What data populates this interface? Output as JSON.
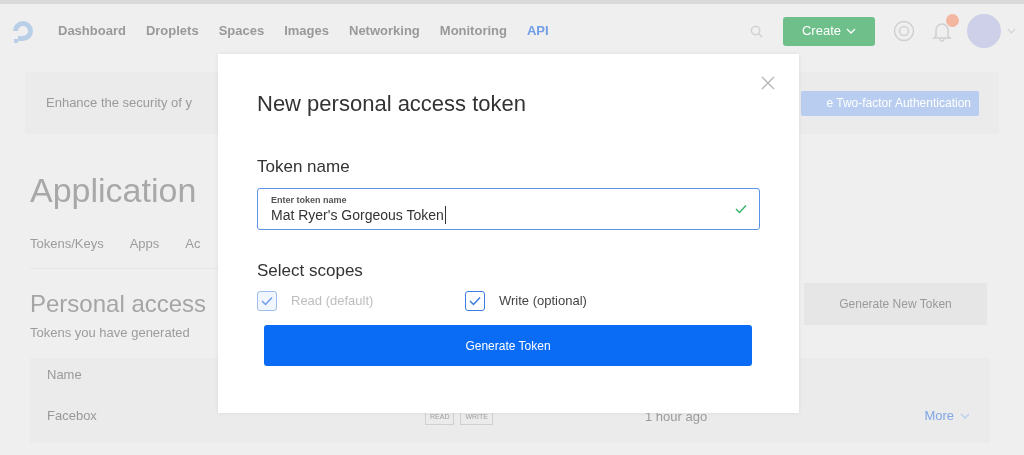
{
  "nav": {
    "links": [
      {
        "label": "Dashboard",
        "selected": false
      },
      {
        "label": "Droplets",
        "selected": false
      },
      {
        "label": "Spaces",
        "selected": false
      },
      {
        "label": "Images",
        "selected": false
      },
      {
        "label": "Networking",
        "selected": false
      },
      {
        "label": "Monitoring",
        "selected": false
      },
      {
        "label": "API",
        "selected": true
      }
    ],
    "create_button": "Create"
  },
  "banner": {
    "text": "Enhance the security of y",
    "button": "e Two-factor Authentication"
  },
  "page_title": "Application",
  "tabs": [
    "Tokens/Keys",
    "Apps",
    "Ac"
  ],
  "section": {
    "title": "Personal access",
    "subtitle": "Tokens you have generated",
    "button": "Generate New Token"
  },
  "table": {
    "columns": [
      "Name"
    ],
    "rows": [
      {
        "name": "Facebox",
        "scopes": [
          "READ",
          "WRITE"
        ],
        "time": "1 hour ago",
        "action": "More"
      }
    ]
  },
  "modal": {
    "title": "New personal access token",
    "token_label": "Token name",
    "field": {
      "label": "Enter token name",
      "value": "Mat Ryer's Gorgeous Token",
      "valid": true
    },
    "scopes_label": "Select scopes",
    "scopes": [
      {
        "label": "Read (default)",
        "checked": true,
        "disabled": true
      },
      {
        "label": "Write (optional)",
        "checked": true,
        "disabled": false
      }
    ],
    "submit": "Generate Token"
  }
}
